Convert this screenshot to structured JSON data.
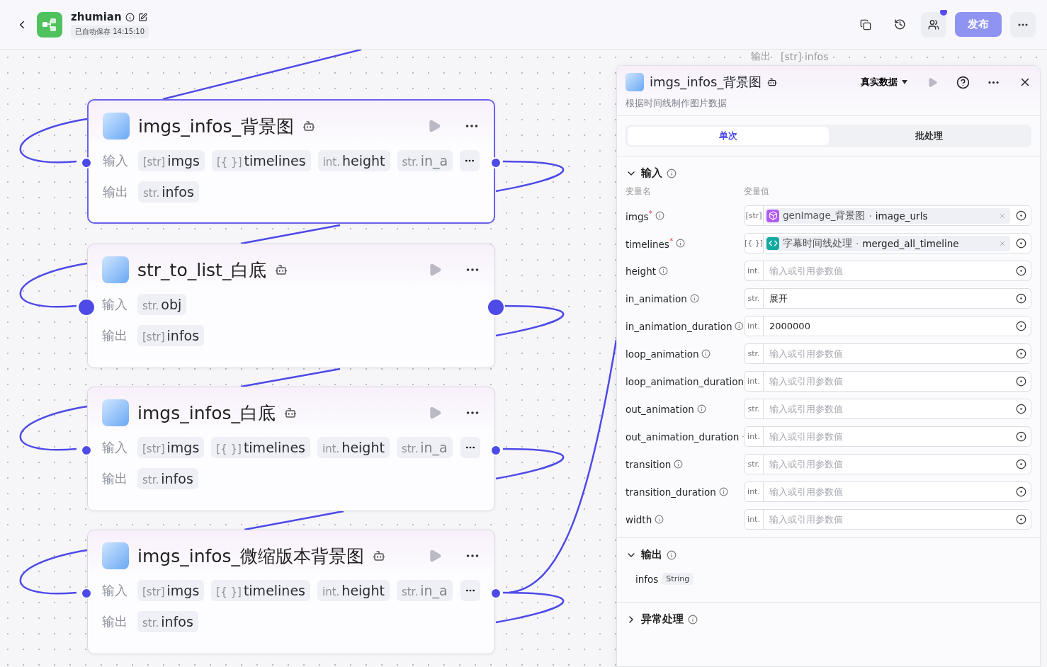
{
  "header": {
    "title": "zhumian",
    "autosave": "已自动保存 14:15:10",
    "publish": "发布"
  },
  "peek": {
    "label": "输出",
    "type": "[str]",
    "name": "infos"
  },
  "nodes": [
    {
      "title": "imgs_infos_背景图",
      "selected": true,
      "big_ports": false,
      "in_label": "输入",
      "out_label": "输出",
      "inputs": [
        {
          "type": "[str]",
          "name": "imgs",
          "faded": false
        },
        {
          "type": "[{ }]",
          "name": "timelines",
          "faded": false
        },
        {
          "type": "int.",
          "name": "height",
          "faded": false
        },
        {
          "type": "str.",
          "name": "in_a",
          "faded": true
        }
      ],
      "more": true,
      "outputs": [
        {
          "type": "str.",
          "name": "infos",
          "faded": false
        }
      ]
    },
    {
      "title": "str_to_list_白底",
      "selected": false,
      "big_ports": true,
      "in_label": "输入",
      "out_label": "输出",
      "inputs": [
        {
          "type": "str.",
          "name": "obj",
          "faded": false
        }
      ],
      "more": false,
      "outputs": [
        {
          "type": "[str]",
          "name": "infos",
          "faded": false
        }
      ]
    },
    {
      "title": "imgs_infos_白底",
      "selected": false,
      "big_ports": false,
      "in_label": "输入",
      "out_label": "输出",
      "inputs": [
        {
          "type": "[str]",
          "name": "imgs",
          "faded": false
        },
        {
          "type": "[{ }]",
          "name": "timelines",
          "faded": false
        },
        {
          "type": "int.",
          "name": "height",
          "faded": false
        },
        {
          "type": "str.",
          "name": "in_a",
          "faded": true
        }
      ],
      "more": true,
      "outputs": [
        {
          "type": "str.",
          "name": "infos",
          "faded": false
        }
      ]
    },
    {
      "title": "imgs_infos_微缩版本背景图",
      "selected": false,
      "big_ports": false,
      "in_label": "输入",
      "out_label": "输出",
      "inputs": [
        {
          "type": "[str]",
          "name": "imgs",
          "faded": false
        },
        {
          "type": "[{ }]",
          "name": "timelines",
          "faded": false
        },
        {
          "type": "int.",
          "name": "height",
          "faded": false
        },
        {
          "type": "str.",
          "name": "in_a",
          "faded": true
        }
      ],
      "more": true,
      "outputs": [
        {
          "type": "str.",
          "name": "infos",
          "faded": false
        }
      ]
    }
  ],
  "panel": {
    "title": "imgs_infos_背景图",
    "description": "根据时间线制作图片数据",
    "data_mode": "真实数据",
    "tabs": [
      {
        "label": "单次",
        "selected": true
      },
      {
        "label": "批处理",
        "selected": false
      }
    ],
    "input_section": {
      "title": "输入",
      "expanded": true,
      "col_name": "变量名",
      "col_value": "变量值"
    },
    "params": [
      {
        "name": "imgs",
        "required_mark": "*",
        "type": "[str]",
        "kind": "image_ref",
        "source": "genImage_背景图",
        "sep": "·",
        "field": "image_urls"
      },
      {
        "name": "timelines",
        "required_mark": "*",
        "type": "[{ }]",
        "kind": "code_ref",
        "source": "字幕时间线处理",
        "sep": "·",
        "field": "merged_all_timeline"
      },
      {
        "name": "height",
        "type": "int.",
        "kind": "input",
        "placeholder": "输入或引用参数值"
      },
      {
        "name": "in_animation",
        "type": "str.",
        "kind": "input",
        "value": "展开"
      },
      {
        "name": "in_animation_duration",
        "type": "int.",
        "kind": "input",
        "value": "2000000"
      },
      {
        "name": "loop_animation",
        "type": "str.",
        "kind": "input",
        "placeholder": "输入或引用参数值"
      },
      {
        "name": "loop_animation_duration",
        "type": "int.",
        "kind": "input",
        "placeholder": "输入或引用参数值"
      },
      {
        "name": "out_animation",
        "type": "str.",
        "kind": "input",
        "placeholder": "输入或引用参数值"
      },
      {
        "name": "out_animation_duration",
        "type": "int.",
        "kind": "input",
        "placeholder": "输入或引用参数值"
      },
      {
        "name": "transition",
        "type": "str.",
        "kind": "input",
        "placeholder": "输入或引用参数值"
      },
      {
        "name": "transition_duration",
        "type": "int.",
        "kind": "input",
        "placeholder": "输入或引用参数值"
      },
      {
        "name": "width",
        "type": "int.",
        "kind": "input",
        "placeholder": "输入或引用参数值"
      }
    ],
    "output_section": {
      "title": "输出",
      "expanded": true,
      "outputs": [
        {
          "name": "infos",
          "type": "String"
        }
      ]
    },
    "error_section": {
      "title": "异常处理",
      "expanded": false
    }
  }
}
